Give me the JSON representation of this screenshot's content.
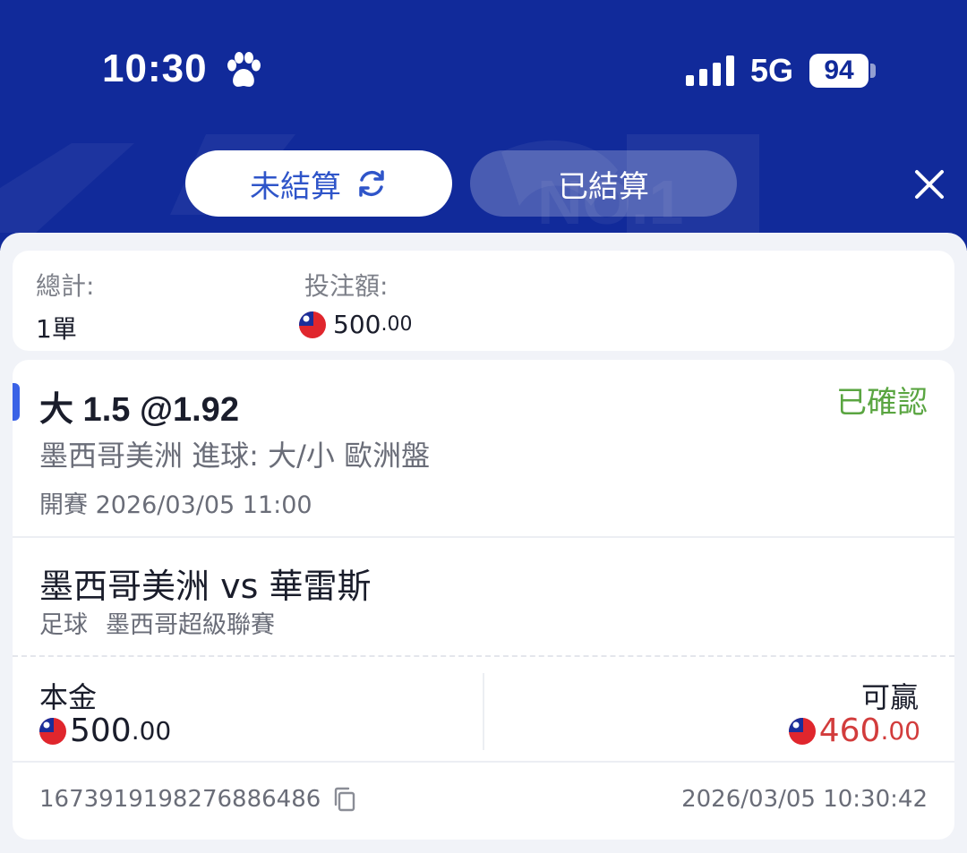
{
  "status_bar": {
    "time": "10:30",
    "network": "5G",
    "battery": "94"
  },
  "tabs": {
    "unsettled": "未結算",
    "settled": "已結算"
  },
  "summary": {
    "total_label": "總計:",
    "total_value": "1單",
    "stake_label": "投注額:",
    "stake_int": "500",
    "stake_dec": ".00"
  },
  "bet": {
    "pick": "大 1.5 @1.92",
    "status": "已確認",
    "status_color": "#5aa541",
    "market": "墨西哥美洲 進球: 大/小 歐洲盤",
    "kickoff_label": "開賽",
    "kickoff_time": "2026/03/05 11:00",
    "match": "墨西哥美洲 vs 華雷斯",
    "sport": "足球",
    "league": "墨西哥超級聯賽",
    "stake_label": "本金",
    "stake_int": "500",
    "stake_dec": ".00",
    "win_label": "可贏",
    "win_int": "460",
    "win_dec": ".00",
    "win_color": "#d23c3c",
    "bet_id": "1673919198276886486",
    "placed_time": "2026/03/05 10:30:42"
  },
  "colors": {
    "header_bg": "#112a9a",
    "accent": "#3a62e6"
  }
}
